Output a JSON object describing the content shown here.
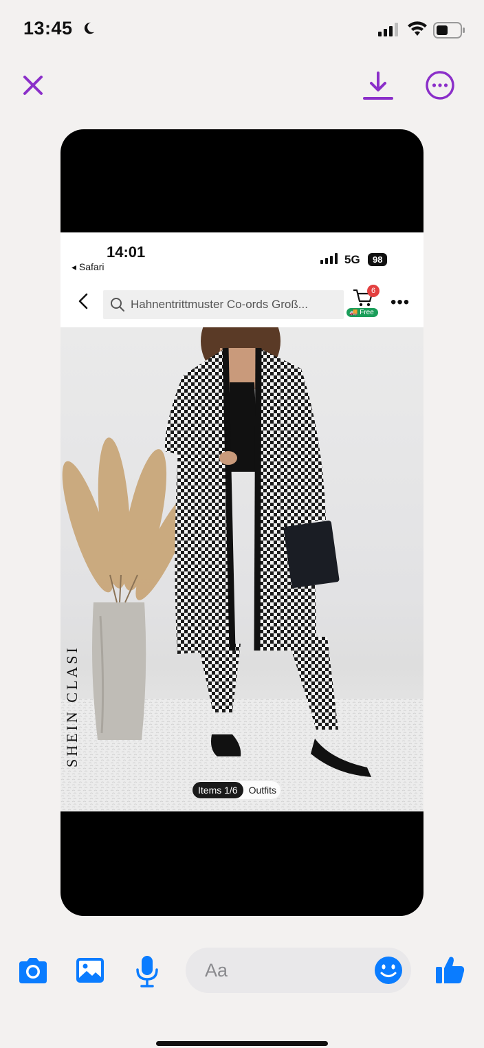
{
  "status_bar": {
    "time": "13:45",
    "moon_icon": "moon-icon",
    "signal_icon": "cellular-signal-icon",
    "wifi_icon": "wifi-icon",
    "battery_icon": "battery-icon"
  },
  "viewer_toolbar": {
    "close_icon": "close-icon",
    "download_icon": "download-icon",
    "more_icon": "more-options-icon",
    "accent_color": "#8b2fc9"
  },
  "shared_screenshot": {
    "status": {
      "time": "14:01",
      "back_app": "◂ Safari",
      "network": "5G",
      "battery": "98"
    },
    "nav": {
      "search_text": "Hahnentrittmuster Co-ords Groß...",
      "cart_badge": "6",
      "free_label": "Free"
    },
    "product": {
      "brand_watermark": "SHEIN CLASI",
      "items_count": "Items 1/6",
      "outfits_label": "Outfits"
    }
  },
  "composer": {
    "placeholder": "Aa",
    "camera_icon": "camera-icon",
    "gallery_icon": "image-icon",
    "mic_icon": "microphone-icon",
    "emoji_icon": "emoji-icon",
    "like_icon": "thumbs-up-icon",
    "accent_color": "#0a7cff"
  }
}
